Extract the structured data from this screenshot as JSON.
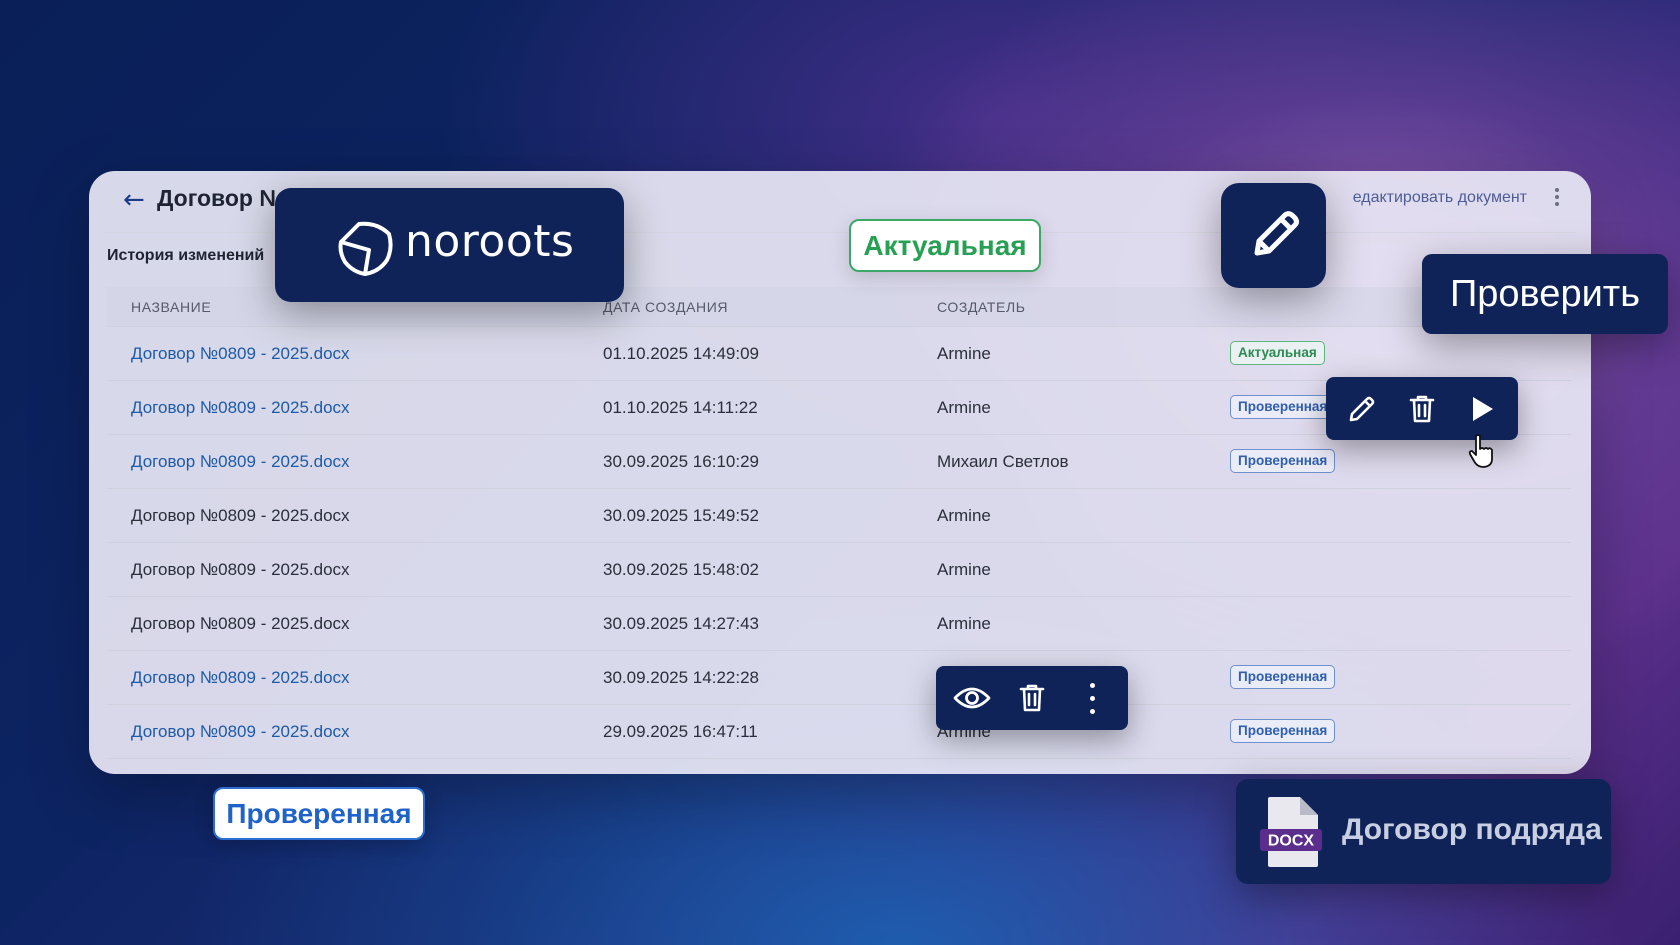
{
  "header": {
    "back_icon": "arrow-left-icon",
    "title": "Договор №0",
    "edit_link": "едактировать документ"
  },
  "history": {
    "label": "История изменений"
  },
  "table": {
    "columns": [
      "НАЗВАНИЕ",
      "ДАТА СОЗДАНИЯ",
      "СОЗДАТЕЛЬ"
    ],
    "rows": [
      {
        "name": "Договор №0809 - 2025.docx",
        "date": "01.10.2025 14:49:09",
        "creator": "Armine",
        "status": "Актуальная"
      },
      {
        "name": "Договор №0809 - 2025.docx",
        "date": "01.10.2025 14:11:22",
        "creator": "Armine",
        "status": "Проверенная"
      },
      {
        "name": "Договор №0809 - 2025.docx",
        "date": "30.09.2025 16:10:29",
        "creator": "Михаил Светлов",
        "status": "Проверенная"
      },
      {
        "name": "Договор №0809 - 2025.docx",
        "date": "30.09.2025 15:49:52",
        "creator": "Armine",
        "status": ""
      },
      {
        "name": "Договор №0809 - 2025.docx",
        "date": "30.09.2025 15:48:02",
        "creator": "Armine",
        "status": ""
      },
      {
        "name": "Договор №0809 - 2025.docx",
        "date": "30.09.2025 14:27:43",
        "creator": "Armine",
        "status": ""
      },
      {
        "name": "Договор №0809 - 2025.docx",
        "date": "30.09.2025 14:22:28",
        "creator": "",
        "status": "Проверенная"
      },
      {
        "name": "Договор №0809 - 2025.docx",
        "date": "29.09.2025 16:47:11",
        "creator": "Armine",
        "status": "Проверенная"
      }
    ]
  },
  "overlays": {
    "logo_text": "noroots",
    "badge_actual": "Актуальная",
    "check_button": "Проверить",
    "badge_verified": "Проверенная",
    "file_type": "DOCX",
    "file_name": "Договор подряда"
  },
  "colors": {
    "brand_navy": "#0f2359",
    "link_blue": "#1d5aa8",
    "actual_green": "#28a054",
    "verified_blue": "#1f63c8"
  }
}
